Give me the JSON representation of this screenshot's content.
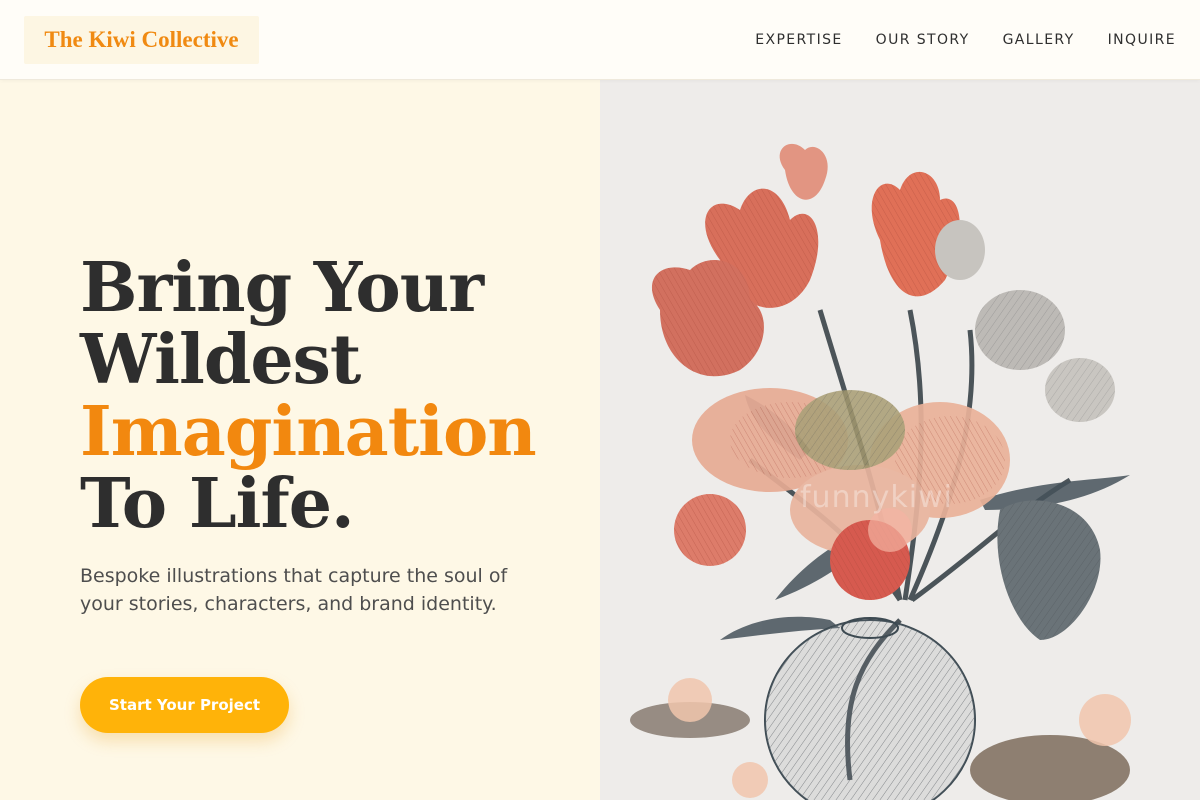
{
  "header": {
    "logo": "The Kiwi Collective",
    "nav": [
      "EXPERTISE",
      "OUR STORY",
      "GALLERY",
      "INQUIRE"
    ]
  },
  "hero": {
    "headline_line1": "Bring Your",
    "headline_line2": "Wildest",
    "headline_accent": "Imagination",
    "headline_line4": "To Life.",
    "subtitle": "Bespoke illustrations that capture the soul of your stories, characters, and brand identity.",
    "cta_label": "Start Your Project"
  },
  "image": {
    "subject": "vintage engraved floral bouquet in a glass vase",
    "watermark": "funnykiwi"
  },
  "colors": {
    "accent": "#f2880f",
    "cta": "#ffb309",
    "left_bg": "#fef8e6",
    "text_dark": "#2e2e2e"
  }
}
